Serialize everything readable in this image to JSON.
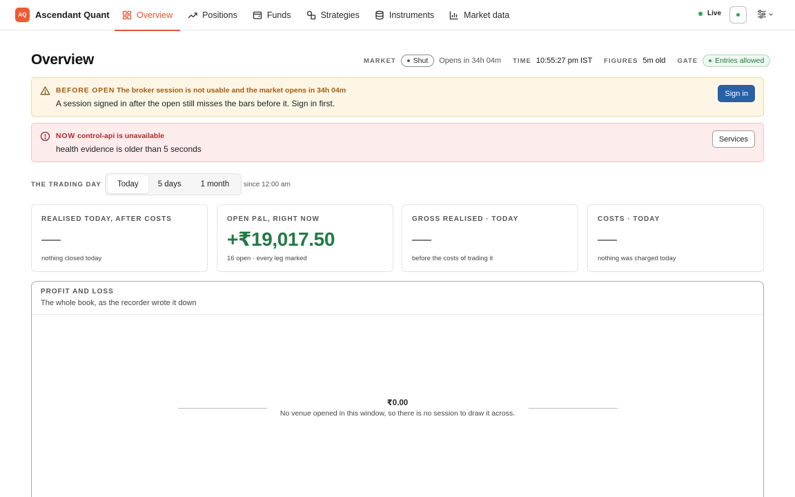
{
  "brand": {
    "logo": "AQ",
    "name": "Ascendant Quant",
    "color": "#ec5b35"
  },
  "nav": [
    {
      "label": "Overview",
      "icon": "dashboard-icon",
      "active": true
    },
    {
      "label": "Positions",
      "icon": "trend-up-icon"
    },
    {
      "label": "Funds",
      "icon": "wallet-icon"
    },
    {
      "label": "Strategies",
      "icon": "shapes-icon"
    },
    {
      "label": "Instruments",
      "icon": "database-icon"
    },
    {
      "label": "Market data",
      "icon": "bar-chart-icon"
    }
  ],
  "status": {
    "live_label": "Live",
    "live_color": "#2aa55a"
  },
  "header": {
    "title": "Overview",
    "market_label": "MARKET",
    "market_state": "Shut",
    "market_opens": "Opens in 34h 04m",
    "time_label": "TIME",
    "time_value": "10:55:27 pm IST",
    "figures_label": "FIGURES",
    "figures_value": "5m old",
    "gate_label": "GATE",
    "gate_value": "Entries allowed"
  },
  "alerts": {
    "before_open": {
      "tag": "BEFORE OPEN",
      "headline": "The broker session is not usable and the market opens in 34h 04m",
      "detail": "A session signed in after the open still misses the bars before it. Sign in first.",
      "action": "Sign in"
    },
    "now": {
      "tag": "NOW",
      "headline": "control-api is unavailable",
      "detail": "health evidence is older than 5 seconds",
      "action": "Services"
    }
  },
  "trading_day": {
    "label": "THE TRADING DAY",
    "ranges": [
      "Today",
      "5 days",
      "1 month"
    ],
    "selected": "Today",
    "since": "since 12:00 am"
  },
  "cards": [
    {
      "label": "REALISED TODAY, AFTER COSTS",
      "value": "—",
      "note": "nothing closed today"
    },
    {
      "label": "OPEN P&L, RIGHT NOW",
      "value": "+₹19,017.50",
      "note": "16 open · every leg marked"
    },
    {
      "label": "GROSS REALISED · TODAY",
      "value": "—",
      "note": "before the costs of trading it"
    },
    {
      "label": "COSTS · TODAY",
      "value": "—",
      "note": "nothing was charged today"
    }
  ],
  "pnl": {
    "title": "PROFIT AND LOSS",
    "subtitle": "The whole book, as the recorder wrote it down",
    "value": "₹0.00",
    "note": "No venue opened in this window, so there is no session to draw it across."
  }
}
